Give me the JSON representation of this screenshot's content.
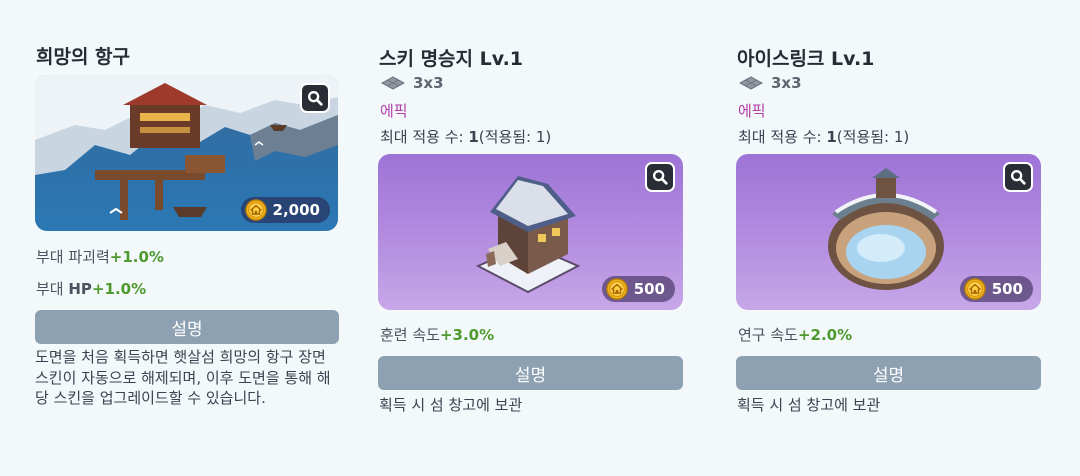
{
  "cards": [
    {
      "title": "희망의 항구",
      "price": "2,000",
      "stats": [
        {
          "label": "부대 파괴력",
          "bonus": "+1.0%"
        },
        {
          "label": "부대 ",
          "label_bold": "HP",
          "bonus": "+1.0%"
        }
      ],
      "desc_button": "설명",
      "description": "도면을 처음 획득하면 햇살섬 희망의 항구 장면 스킨이 자동으로 해제되며, 이후 도면을 통해 해당 스킨을 업그레이드할 수 있습니다."
    },
    {
      "title": "스키 명승지 Lv.1",
      "size": "3x3",
      "rarity": "에픽",
      "limit_label": "최대 적용 수: ",
      "limit_value": "1",
      "limit_applied": "(적용됨: 1)",
      "price": "500",
      "stat": {
        "label": "훈련 속도",
        "bonus": "+3.0%"
      },
      "desc_button": "설명",
      "description": "획득 시 섬 창고에 보관"
    },
    {
      "title": "아이스링크 Lv.1",
      "size": "3x3",
      "rarity": "에픽",
      "limit_label": "최대 적용 수: ",
      "limit_value": "1",
      "limit_applied": "(적용됨: 1)",
      "price": "500",
      "stat": {
        "label": "연구 속도",
        "bonus": "+2.0%"
      },
      "desc_button": "설명",
      "description": "획득 시 섬 창고에 보관"
    }
  ],
  "colors": {
    "bonus": "#4f9a2e",
    "rarity_epic": "#b23ea8",
    "desc_button": "#8da1b2",
    "card_purple": "#b48de0"
  },
  "icons": [
    "magnifier-icon",
    "coin-icon",
    "tile-size-icon"
  ]
}
